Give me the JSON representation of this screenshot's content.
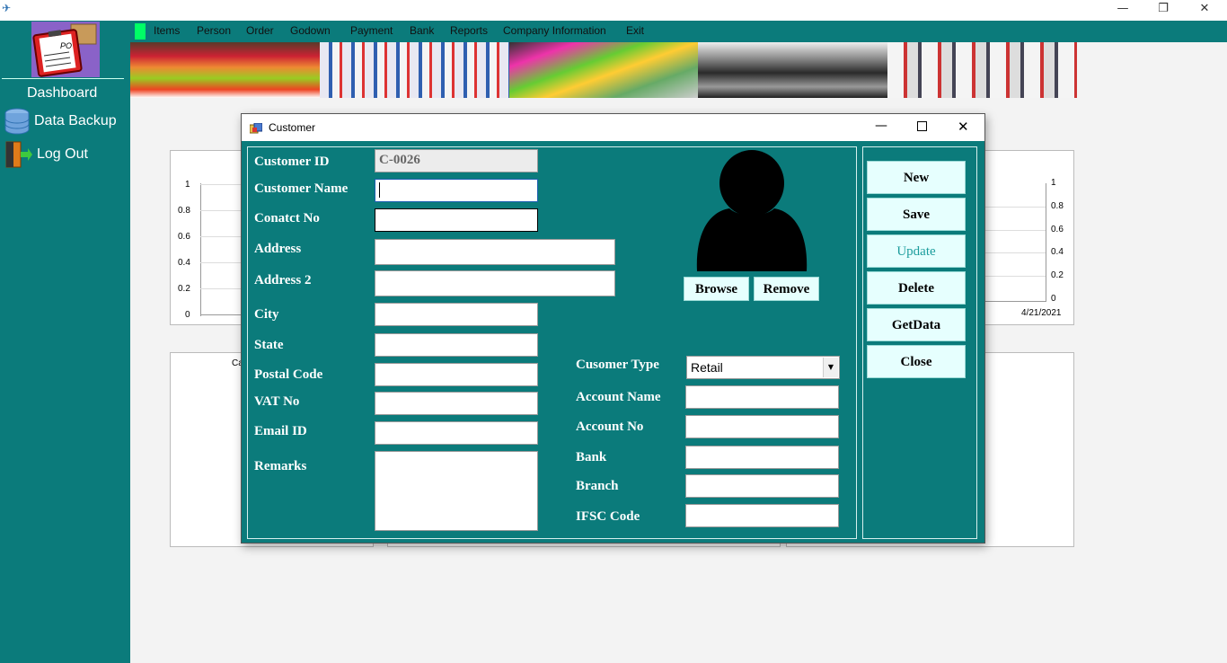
{
  "window": {
    "minimize": "—",
    "restore": "❐",
    "close": "✕"
  },
  "sidebar": {
    "logo_text": "PO",
    "items": [
      {
        "label": "Dashboard"
      },
      {
        "label": "Data Backup"
      },
      {
        "label": "Log Out"
      }
    ]
  },
  "menu": [
    "Items",
    "Person",
    "Order",
    "Godown",
    "Payment",
    "Bank",
    "Reports",
    "Company Information",
    "Exit"
  ],
  "chart_left": {
    "yticks": [
      "1",
      "0.8",
      "0.6",
      "0.4",
      "0.2",
      "0"
    ]
  },
  "chart_right": {
    "yticks": [
      "1",
      "0.8",
      "0.6",
      "0.4",
      "0.2",
      "0"
    ],
    "xtick": "4/21/2021"
  },
  "chart_bottom_left_label": "Ca",
  "dialog": {
    "title": "Customer",
    "fields": {
      "customer_id": {
        "label": "Customer ID",
        "value": "C-0026"
      },
      "customer_name": {
        "label": "Customer Name",
        "value": ""
      },
      "contact_no": {
        "label": "Conatct No",
        "value": ""
      },
      "address": {
        "label": "Address",
        "value": ""
      },
      "address2": {
        "label": "Address 2",
        "value": ""
      },
      "city": {
        "label": "City",
        "value": ""
      },
      "state": {
        "label": "State",
        "value": ""
      },
      "postal_code": {
        "label": "Postal Code",
        "value": ""
      },
      "vat_no": {
        "label": "VAT No",
        "value": ""
      },
      "email_id": {
        "label": "Email ID",
        "value": ""
      },
      "remarks": {
        "label": "Remarks",
        "value": ""
      },
      "customer_type": {
        "label": "Cusomer Type",
        "value": "Retail"
      },
      "account_name": {
        "label": "Account Name",
        "value": ""
      },
      "account_no": {
        "label": "Account No",
        "value": ""
      },
      "bank": {
        "label": "Bank",
        "value": ""
      },
      "branch": {
        "label": "Branch",
        "value": ""
      },
      "ifsc_code": {
        "label": "IFSC Code",
        "value": ""
      }
    },
    "photo_buttons": {
      "browse": "Browse",
      "remove": "Remove"
    },
    "actions": {
      "new": "New",
      "save": "Save",
      "update": "Update",
      "delete": "Delete",
      "getdata": "GetData",
      "close": "Close"
    }
  },
  "colors": {
    "teal": "#0b7b7b",
    "button_bg": "#e6fffe",
    "update_text": "#1a9c9c"
  }
}
